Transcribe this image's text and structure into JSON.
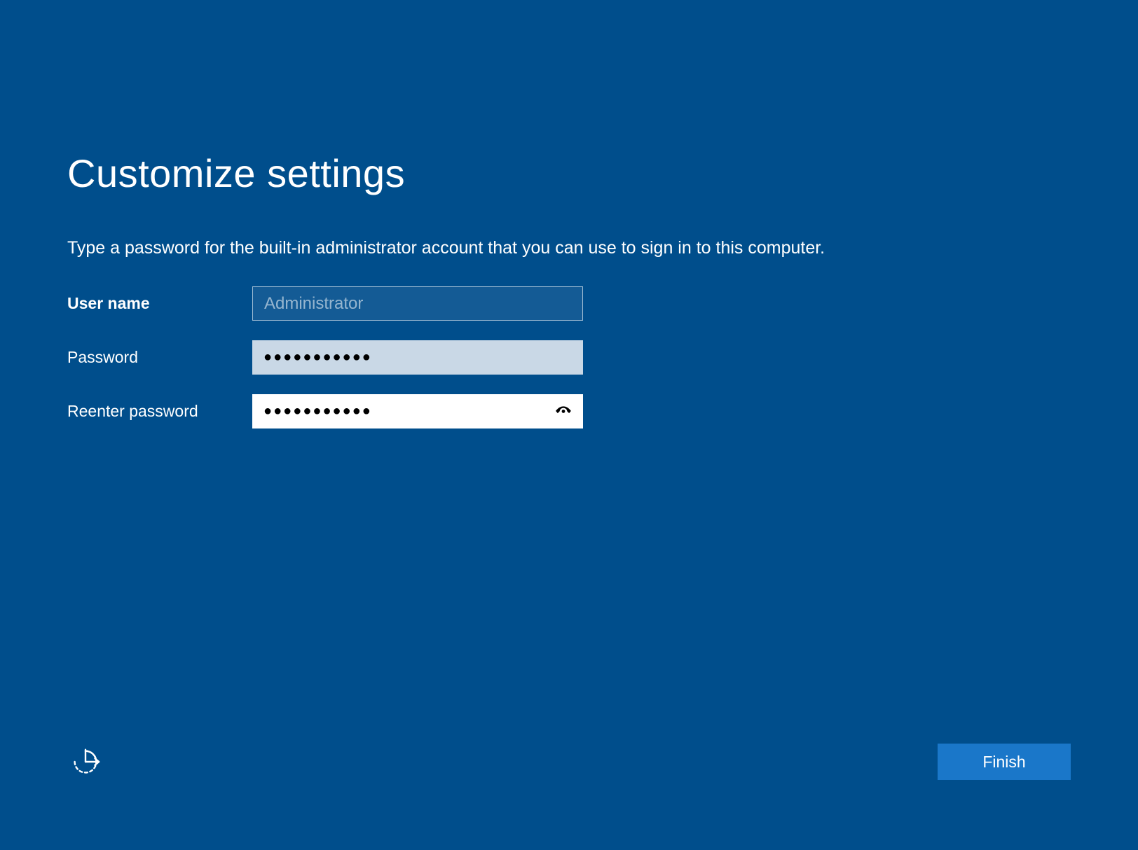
{
  "title": "Customize settings",
  "instruction": "Type a password for the built-in administrator account that you can use to sign in to this computer.",
  "form": {
    "username_label": "User name",
    "username_value": "Administrator",
    "password_label": "Password",
    "password_mask": "●●●●●●●●●●●",
    "reenter_label": "Reenter password",
    "reenter_mask": "●●●●●●●●●●●"
  },
  "footer": {
    "finish_label": "Finish"
  }
}
